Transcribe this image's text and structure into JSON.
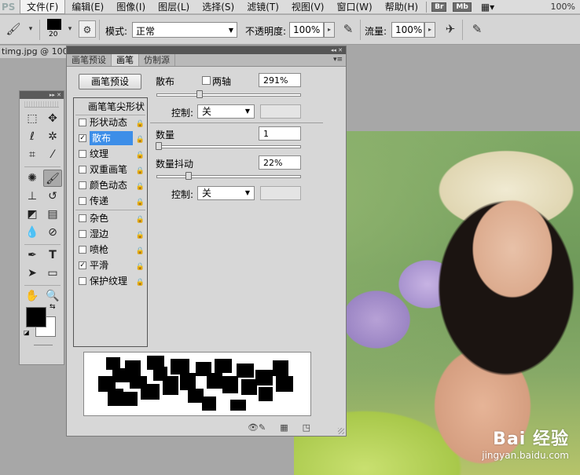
{
  "menubar": {
    "logo": "PS",
    "items": [
      "文件(F)",
      "编辑(E)",
      "图像(I)",
      "图层(L)",
      "选择(S)",
      "滤镜(T)",
      "视图(V)",
      "窗口(W)",
      "帮助(H)"
    ],
    "badges": [
      "Br",
      "Mb"
    ],
    "zoom": "100%"
  },
  "options": {
    "brush_size": "20",
    "mode_label": "模式:",
    "mode_value": "正常",
    "opacity_label": "不透明度:",
    "opacity_value": "100%",
    "flow_label": "流量:",
    "flow_value": "100%"
  },
  "document": {
    "tab_title": "timg.jpg @ 100"
  },
  "watermark": {
    "brand": "Bai 经验",
    "url": "jingyan.baidu.com"
  },
  "brush_panel": {
    "tabs": [
      "画笔预设",
      "画笔",
      "仿制源"
    ],
    "active_tab": "画笔",
    "preset_button": "画笔预设",
    "list_header": "画笔笔尖形状",
    "list_items": [
      {
        "label": "形状动态",
        "checked": false,
        "selected": false
      },
      {
        "label": "散布",
        "checked": true,
        "selected": true
      },
      {
        "label": "纹理",
        "checked": false,
        "selected": false
      },
      {
        "label": "双重画笔",
        "checked": false,
        "selected": false
      },
      {
        "label": "颜色动态",
        "checked": false,
        "selected": false
      },
      {
        "label": "传递",
        "checked": false,
        "selected": false
      },
      {
        "label": "杂色",
        "checked": false,
        "selected": false
      },
      {
        "label": "湿边",
        "checked": false,
        "selected": false
      },
      {
        "label": "喷枪",
        "checked": false,
        "selected": false
      },
      {
        "label": "平滑",
        "checked": true,
        "selected": false
      },
      {
        "label": "保护纹理",
        "checked": false,
        "selected": false
      }
    ],
    "scatter": {
      "label": "散布",
      "both_axes_label": "两轴",
      "value": "291%",
      "control_label": "控制:",
      "control_value": "关"
    },
    "count": {
      "label": "数量",
      "value": "1"
    },
    "count_jitter": {
      "label": "数量抖动",
      "value": "22%",
      "control_label": "控制:",
      "control_value": "关"
    }
  }
}
